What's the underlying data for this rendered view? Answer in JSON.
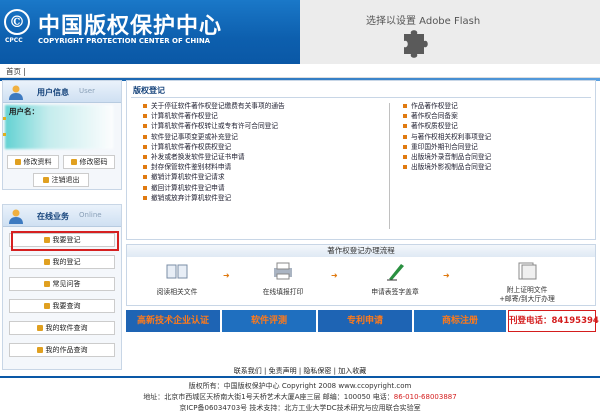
{
  "header": {
    "logo_char": "©",
    "logo_text": "CPCC",
    "title": "中国版权保护中心",
    "subtitle": "COPYRIGHT PROTECTION CENTER OF CHINA",
    "flash_text": "选择以设置 Adobe Flash",
    "plugin_icon": "puzzle-piece-icon"
  },
  "nav": {
    "home": "首页 |"
  },
  "sidebar": {
    "user_info": {
      "title": "用户信息",
      "title_en": "User",
      "user_label": "用户名：",
      "buttons": [
        "修改资料",
        "修改密码",
        "注销退出"
      ]
    },
    "online": {
      "title": "在线业务",
      "title_en": "Online",
      "buttons": [
        "我要登记",
        "我的登记",
        "常见问答",
        "我要查询",
        "我的软件查询",
        "我的作品查询"
      ]
    }
  },
  "register": {
    "title": "版权登记",
    "left_items": [
      "关于停征软件著作权登记缴费有关事项的通告",
      "计算机软件著作权登记",
      "计算机软件著作权转让或专有许可合同登记",
      "软件登记事项变更或补充登记",
      "计算机软件著作权质权登记",
      "补发或者换发软件登记证书申请",
      "封存保管软件鉴别材料申请",
      "撤销计算机软件登记请求",
      "撤回计算机软件登记申请",
      "撤销或放弃计算机软件登记"
    ],
    "right_items": [
      "作品著作权登记",
      "著作权合同备案",
      "著作权质权登记",
      "与著作权相关权利事项登记",
      "重印国外期刊合同登记",
      "出版境外录音制品合同登记",
      "出版境外影视制品合同登记"
    ]
  },
  "flow": {
    "title": "著作权登记办理流程",
    "steps": [
      "阅读相关文件",
      "在线填报打印",
      "申请表签字盖章",
      "附上证明文件\n+邮寄/到大厅办理"
    ]
  },
  "banners": [
    {
      "text": "高新技术企业认证",
      "color": "#1e64b4"
    },
    {
      "text": "软件评测",
      "color": "#1f6fbf"
    },
    {
      "text": "专利申请",
      "color": "#1e64b4"
    },
    {
      "text": "商标注册",
      "color": "#1f6fbf"
    }
  ],
  "hotline": "刊登电话：84195394",
  "footer": {
    "links": "联系我们 | 免责声明 | 隐私保密 | 加入收藏",
    "copyright": "版权所有：中国版权保护中心 Copyright 2008 www.ccopyright.com",
    "address": "地址：北京市西城区天桥南大街1号天桥艺术大厦A座三层 邮编：100050 电话：",
    "phone": "86-010-68003887",
    "icp": "京ICP备06034703号 技术支持：北方工业大学DC技术研究与应用联合实验室"
  },
  "colors": {
    "brand_blue": "#0d5fae",
    "accent_orange": "#e07a10",
    "highlight_red": "#d62020"
  }
}
